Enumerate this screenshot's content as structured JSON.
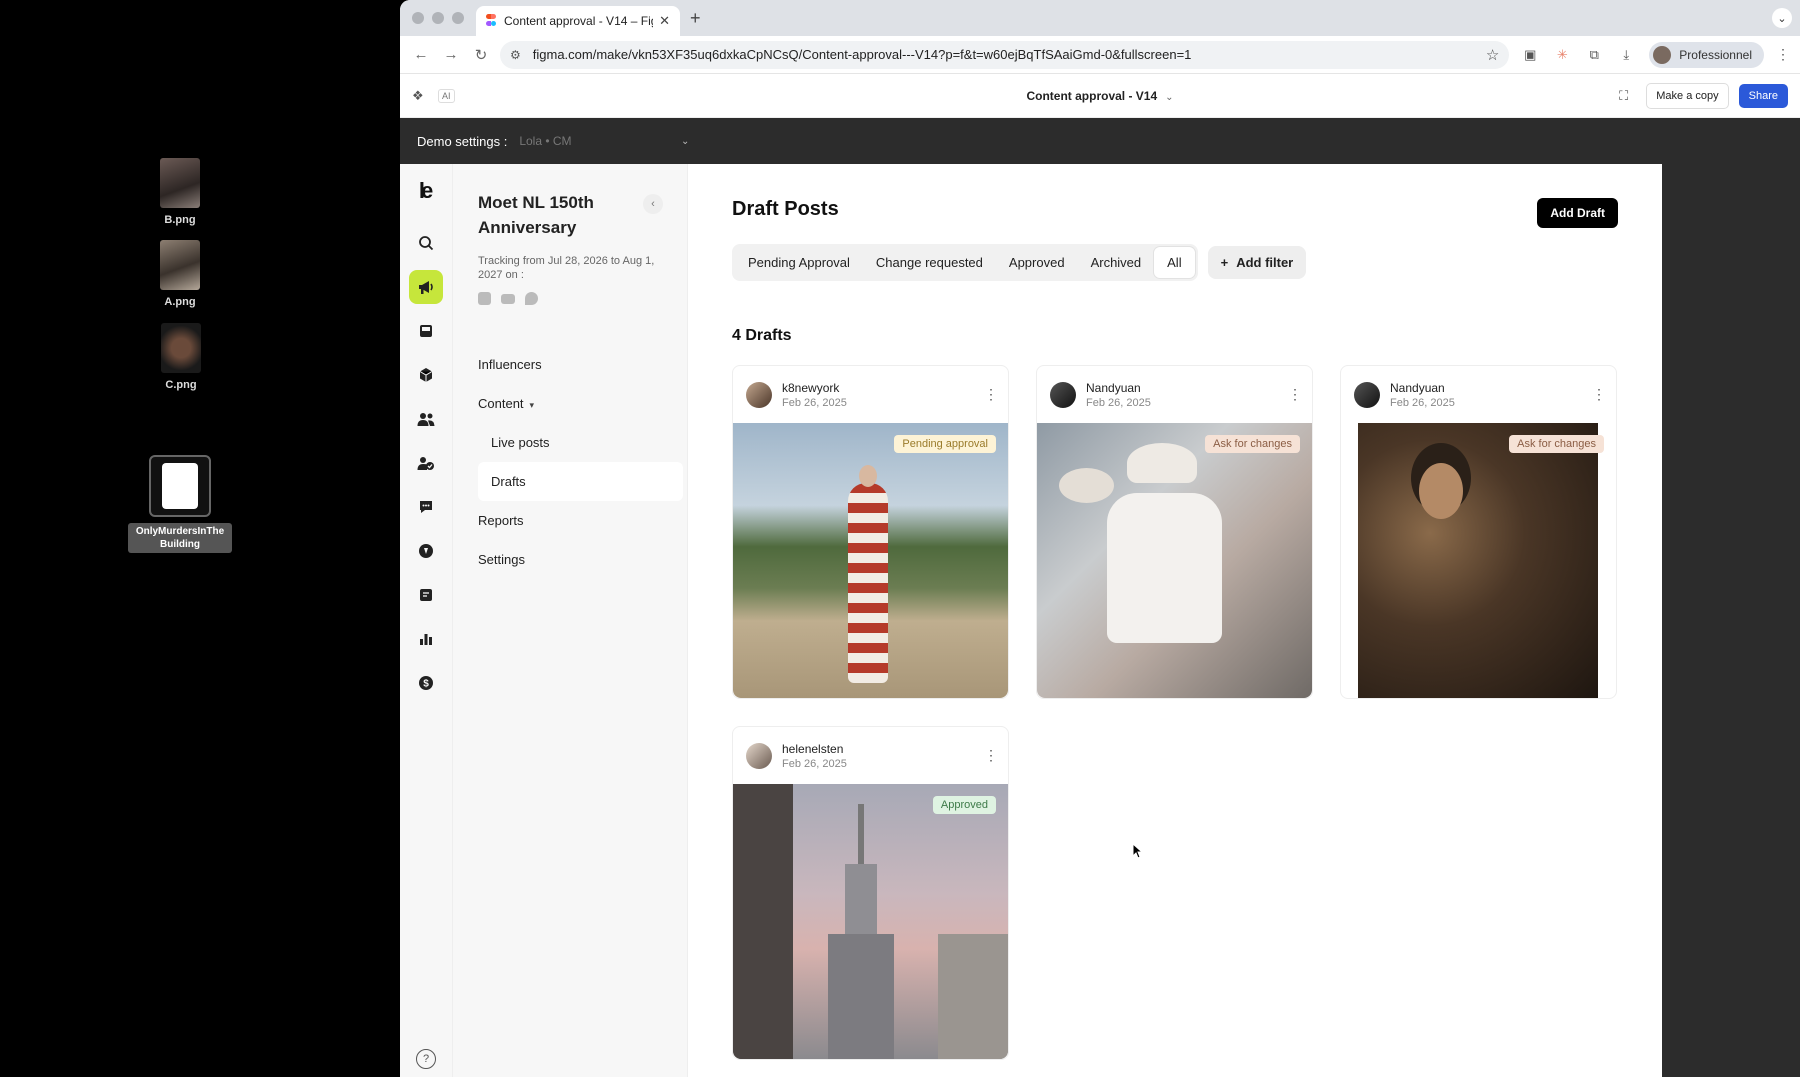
{
  "desktop": {
    "icons": [
      {
        "label": "B.png"
      },
      {
        "label": "A.png"
      },
      {
        "label": "C.png"
      },
      {
        "label": "OnlyMurdersInThe Building"
      }
    ]
  },
  "browser": {
    "tab_title": "Content approval - V14 – Figr",
    "url": "figma.com/make/vkn53XF35uq6dxkaCpNCsQ/Content-approval---V14?p=f&t=w60ejBqTfSAaiGmd-0&fullscreen=1",
    "profile_label": "Professionnel"
  },
  "figma": {
    "ai_label": "AI",
    "file_title": "Content approval - V14",
    "make_copy": "Make a copy",
    "share": "Share"
  },
  "demo": {
    "label": "Demo settings :",
    "value": "Lola • CM"
  },
  "sidebar": {
    "campaign_title": "Moet NL 150th Anniversary",
    "tracking": "Tracking from Jul 28, 2026 to Aug 1, 2027 on :",
    "nav": {
      "influencers": "Influencers",
      "content": "Content",
      "live_posts": "Live posts",
      "drafts": "Drafts",
      "reports": "Reports",
      "settings": "Settings"
    }
  },
  "main": {
    "title": "Draft Posts",
    "add_draft": "Add Draft",
    "filters": [
      "Pending Approval",
      "Change requested",
      "Approved",
      "Archived",
      "All"
    ],
    "active_filter": "All",
    "add_filter": "Add filter",
    "count_label": "4 Drafts",
    "drafts": [
      {
        "user": "k8newyork",
        "date": "Feb 26, 2025",
        "status": "Pending approval"
      },
      {
        "user": "Nandyuan",
        "date": "Feb 26, 2025",
        "status": "Ask for changes"
      },
      {
        "user": "Nandyuan",
        "date": "Feb 26, 2025",
        "status": "Ask for changes"
      },
      {
        "user": "helenelsten",
        "date": "Feb 26, 2025",
        "status": "Approved"
      }
    ]
  },
  "colors": {
    "accent": "#c6e63b",
    "share": "#2b59d9"
  }
}
